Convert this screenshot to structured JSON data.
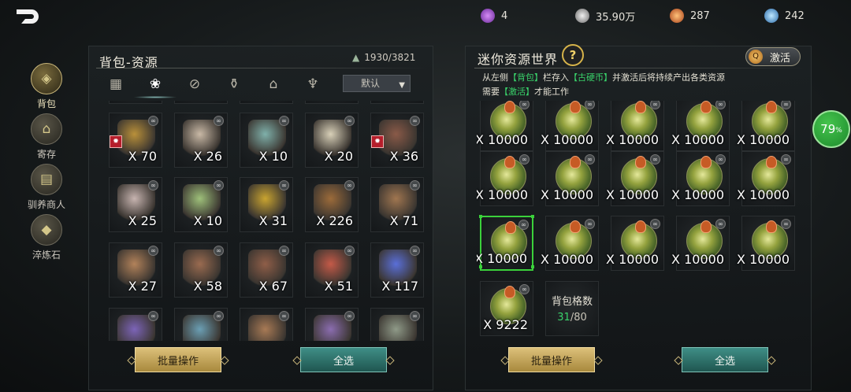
{
  "currencies": [
    {
      "icon": "purple-gem-icon",
      "value": "4",
      "color": "#b15de8"
    },
    {
      "icon": "silver-coin-icon",
      "value": "35.90万",
      "color": "#c8c8c8"
    },
    {
      "icon": "fire-coin-icon",
      "value": "287",
      "color": "#e8782e"
    },
    {
      "icon": "blue-crystal-icon",
      "value": "242",
      "color": "#4aa5e8"
    }
  ],
  "sidebar": {
    "items": [
      {
        "label": "背包",
        "icon": "bag-icon",
        "active": true
      },
      {
        "label": "寄存",
        "icon": "house-icon",
        "active": false
      },
      {
        "label": "驯养商人",
        "icon": "merchant-stall-icon",
        "active": false
      },
      {
        "label": "淬炼石",
        "icon": "stone-icon",
        "active": false
      }
    ]
  },
  "backpack": {
    "title": "背包-资源",
    "capacity": "1930/3821",
    "sort_label": "默认",
    "tabs": [
      {
        "icon": "grid-icon"
      },
      {
        "icon": "resources-icon"
      },
      {
        "icon": "no-bind-icon"
      },
      {
        "icon": "potion-icon"
      },
      {
        "icon": "building-icon"
      },
      {
        "icon": "trophy-icon"
      }
    ],
    "items": [
      {
        "qty": "X 70",
        "color": "#b9903a",
        "badge": true
      },
      {
        "qty": "X 26",
        "color": "#c9b9a6"
      },
      {
        "qty": "X 10",
        "color": "#7fb0aa"
      },
      {
        "qty": "X 20",
        "color": "#d8d0b8"
      },
      {
        "qty": "X 36",
        "color": "#8a5a48",
        "badge": true
      },
      {
        "qty": "X 25",
        "color": "#c7b4b0"
      },
      {
        "qty": "X 10",
        "color": "#9ec07a"
      },
      {
        "qty": "X 31",
        "color": "#c9a430"
      },
      {
        "qty": "X 226",
        "color": "#9c6b3a"
      },
      {
        "qty": "X 71",
        "color": "#a07650"
      },
      {
        "qty": "X 27",
        "color": "#b2825a"
      },
      {
        "qty": "X 58",
        "color": "#9a6b50"
      },
      {
        "qty": "X 67",
        "color": "#8f5e48"
      },
      {
        "qty": "X 51",
        "color": "#c45a48"
      },
      {
        "qty": "X 117",
        "color": "#5a6fd8"
      },
      {
        "qty": "",
        "color": "#7c64b8"
      },
      {
        "qty": "",
        "color": "#6b9fb4"
      },
      {
        "qty": "",
        "color": "#a87a55"
      },
      {
        "qty": "",
        "color": "#8b6db0"
      },
      {
        "qty": "",
        "color": "#8f9a88"
      }
    ],
    "batch_button": "批量操作",
    "select_all_button": "全选"
  },
  "mini_world": {
    "title": "迷你资源世界",
    "activate_label": "激活",
    "desc_line1": {
      "p1": "从左侧",
      "h1": "【背包】",
      "p2": "栏存入",
      "h2": "【古硬币】",
      "p3": "并激活后将持续产出各类资源"
    },
    "desc_line2": {
      "p1": "需要",
      "h1": "【激活】",
      "p2": "才能工作"
    },
    "slots": [
      "X 10000",
      "X 10000",
      "X 10000",
      "X 10000",
      "X 10000",
      "X 10000",
      "X 10000",
      "X 10000",
      "X 10000",
      "X 10000",
      "X 10000",
      "X 10000",
      "X 10000",
      "X 10000",
      "X 10000",
      "X 9222"
    ],
    "selected_index": 10,
    "capacity_label": "背包格数",
    "capacity_used": "31",
    "capacity_total": "/80",
    "progress": "79",
    "progress_unit": "%",
    "batch_button": "批量操作",
    "select_all_button": "全选"
  }
}
